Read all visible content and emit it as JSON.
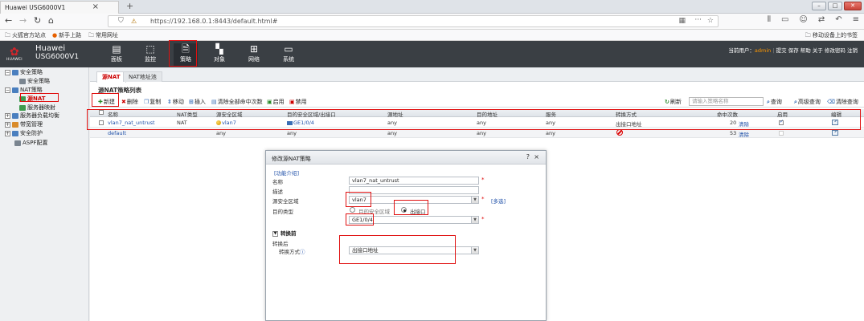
{
  "browser": {
    "tab_title": "Huawei USG6000V1",
    "tab_close": "×",
    "new_tab": "+",
    "url": "https://192.168.0.1:8443/default.html#",
    "bookmarks": [
      {
        "label": "火狐官方站点",
        "icon": "firefox-icon"
      },
      {
        "label": "新手上路",
        "icon": "firefox-icon"
      },
      {
        "label": "常用网址",
        "icon": "folder-icon"
      }
    ],
    "mobile_bookmarks": "移动设备上的书签"
  },
  "header": {
    "brand": "Huawei",
    "product": "USG6000V1",
    "logo_text": "HUAWEI",
    "modules": [
      {
        "label": "面板",
        "icon": "dashboard-icon"
      },
      {
        "label": "监控",
        "icon": "monitor-icon"
      },
      {
        "label": "策略",
        "icon": "policy-icon",
        "active": true
      },
      {
        "label": "对象",
        "icon": "object-icon"
      },
      {
        "label": "网络",
        "icon": "network-icon"
      },
      {
        "label": "系统",
        "icon": "system-icon"
      }
    ],
    "current_user_label": "当前用户：",
    "current_user": "admin",
    "right_links": [
      "提交",
      "保存",
      "帮助",
      "关于",
      "修改密码",
      "注销"
    ]
  },
  "tree": [
    {
      "label": "安全策略",
      "level": 0,
      "toggle": "−"
    },
    {
      "label": "安全策略",
      "level": 1
    },
    {
      "label": "NAT策略",
      "level": 0,
      "toggle": "−"
    },
    {
      "label": "源NAT",
      "level": 1,
      "selected": true
    },
    {
      "label": "服务器映射",
      "level": 1
    },
    {
      "label": "服务器负载均衡",
      "level": 0,
      "toggle": "+"
    },
    {
      "label": "带宽管理",
      "level": 0,
      "toggle": "+"
    },
    {
      "label": "安全防护",
      "level": 0,
      "toggle": "+"
    },
    {
      "label": "ASPF配置",
      "level": 0
    }
  ],
  "subtabs": [
    "源NAT",
    "NAT地址池"
  ],
  "list_title": "源NAT策略列表",
  "toolbar": {
    "new": "新建",
    "delete": "删除",
    "copy": "复制",
    "move": "移动",
    "insert": "插入",
    "clear_hits": "清除全部命中次数",
    "enable": "启用",
    "disable": "禁用",
    "refresh": "刷新",
    "search_placeholder": "请输入策略名称",
    "query": "查询",
    "advanced_query": "高级查询",
    "clear_query": "清除查询"
  },
  "table": {
    "headers": [
      "名称",
      "NAT类型",
      "源安全区域",
      "目的安全区域/出接口",
      "源地址",
      "目的地址",
      "服务",
      "转换方式",
      "命中次数",
      "启用",
      "编辑"
    ],
    "rows": [
      {
        "name": "vlan7_nat_untrust",
        "nat_type": "NAT",
        "src_zone": "vlan7",
        "dst": "GE1/0/4",
        "src_addr": "any",
        "dst_addr": "any",
        "service": "any",
        "translate": "出接口地址",
        "hits": "20",
        "clear": "清除",
        "enabled": true
      },
      {
        "name": "default",
        "nat_type": "any",
        "src_zone": "any",
        "dst": "any",
        "src_addr": "any",
        "dst_addr": "any",
        "service": "any",
        "translate": "",
        "hits": "53",
        "clear": "清除",
        "enabled": false
      }
    ]
  },
  "dialog": {
    "title": "修改源NAT策略",
    "help": "?",
    "close": "×",
    "intro_link": "[功能介绍]",
    "name_label": "名称",
    "name_value": "vlan7_nat_untrust",
    "desc_label": "描述",
    "desc_value": "",
    "src_zone_label": "源安全区域",
    "src_zone_value": "vlan7",
    "multi_select": "[多选]",
    "dst_type_label": "目的类型",
    "dst_type_option1": "目的安全区域",
    "dst_type_option2": "出接口",
    "interface_value": "GE1/0/4",
    "before_section": "转换前",
    "after_label": "转换后",
    "translate_mode_label": "转换方式",
    "translate_mode_value": "出接口地址",
    "required_mark": "*"
  }
}
